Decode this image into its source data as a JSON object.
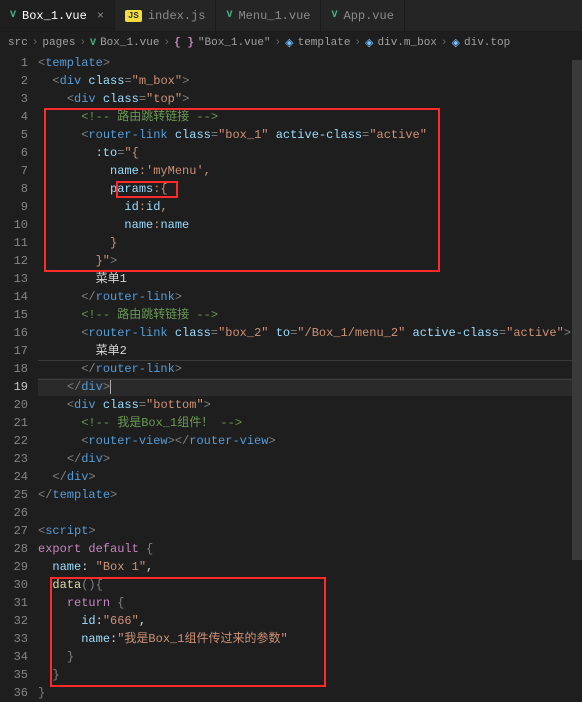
{
  "tabs": [
    {
      "icon": "vue",
      "label": "Box_1.vue",
      "active": true,
      "close": true
    },
    {
      "icon": "js",
      "label": "index.js",
      "active": false,
      "close": false
    },
    {
      "icon": "vue",
      "label": "Menu_1.vue",
      "active": false,
      "close": false
    },
    {
      "icon": "vue",
      "label": "App.vue",
      "active": false,
      "close": false
    }
  ],
  "breadcrumbs": {
    "b0": "src",
    "b1": "pages",
    "b2": "Box_1.vue",
    "b3": "\"Box_1.vue\"",
    "b4": "template",
    "b5": "div.m_box",
    "b6": "div.top"
  },
  "currentLine": 19,
  "lines": {
    "count": 36,
    "l5_attr_class": "class",
    "l5_val_class": "\"box_1\"",
    "l5_attr_ac": "active-class",
    "l5_val_ac": "\"active\"",
    "l6_attr": ":to",
    "l6_val": "\"{",
    "l7_k": "name",
    "l7_v": "'myMenu'",
    "l8_k": "params",
    "l9_k": "id",
    "l9_v": "id",
    "l10_k": "name",
    "l10_v": "name",
    "l12_end": "}\"",
    "l13_txt": "菜单1",
    "l16_val_class": "\"box_2\"",
    "l16_attr_to": "to",
    "l16_val_to": "\"/Box_1/menu_2\"",
    "l17_txt": "菜单2",
    "l20_val": "\"bottom\"",
    "l21_cmt": "<!-- 我是Box_1组件！ -->",
    "l4_cmt": "<!-- 路由跳转链接 -->",
    "l15_cmt": "<!-- 路由跳转链接 -->",
    "l28_kw": "export default",
    "l29_k": "name",
    "l29_v": "\"Box_1\"",
    "l29_v_disp": "\"Box 1\"",
    "l30_fn": "data",
    "l31_kw": "return",
    "l32_k": "id",
    "l32_v": "\"666\"",
    "l33_k": "name",
    "l33_v": "\"我是Box_1组件传过来的参数\""
  },
  "tags": {
    "template": "template",
    "div": "div",
    "routerlink": "router-link",
    "routerview": "router-view",
    "script": "script",
    "class": "class"
  }
}
